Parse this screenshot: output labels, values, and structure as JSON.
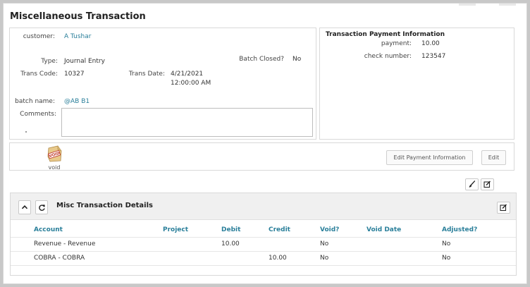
{
  "page": {
    "title": "Miscellaneous Transaction"
  },
  "transaction": {
    "customer_label": "customer:",
    "customer_value": "A Tushar",
    "type_label": "Type:",
    "type_value": "Journal Entry",
    "batch_closed_label": "Batch Closed?",
    "batch_closed_value": "No",
    "trans_code_label": "Trans Code:",
    "trans_code_value": "10327",
    "trans_date_label": "Trans Date:",
    "trans_date_value": "4/21/2021",
    "trans_time_value": "12:00:00 AM",
    "batch_name_label": "batch name:",
    "batch_name_value": "@AB B1",
    "comments_label": "Comments:",
    "comments_value": ""
  },
  "payment_info": {
    "title": "Transaction Payment Information",
    "payment_label": "payment:",
    "payment_value": "10.00",
    "check_number_label": "check number:",
    "check_number_value": "123547"
  },
  "actions": {
    "void_label": "void",
    "void_stamp": "VOID",
    "edit_payment_label": "Edit Payment Information",
    "edit_label": "Edit"
  },
  "details": {
    "title": "Misc Transaction Details",
    "columns": [
      "Account",
      "Project",
      "Debit",
      "Credit",
      "Void?",
      "Void Date",
      "Adjusted?"
    ],
    "rows": [
      {
        "account": "Revenue - Revenue",
        "project": "",
        "debit": "10.00",
        "credit": "",
        "void": "No",
        "void_date": "",
        "adjusted": "No"
      },
      {
        "account": "COBRA - COBRA",
        "project": "",
        "debit": "",
        "credit": "10.00",
        "void": "No",
        "void_date": "",
        "adjusted": "No"
      }
    ]
  },
  "icons": {
    "brush": "paintbrush-icon",
    "edit": "edit-icon",
    "collapse": "chevron-up-icon",
    "refresh": "refresh-icon"
  },
  "colors": {
    "accent": "#2a7f9a",
    "void_stamp": "#c0392b"
  }
}
